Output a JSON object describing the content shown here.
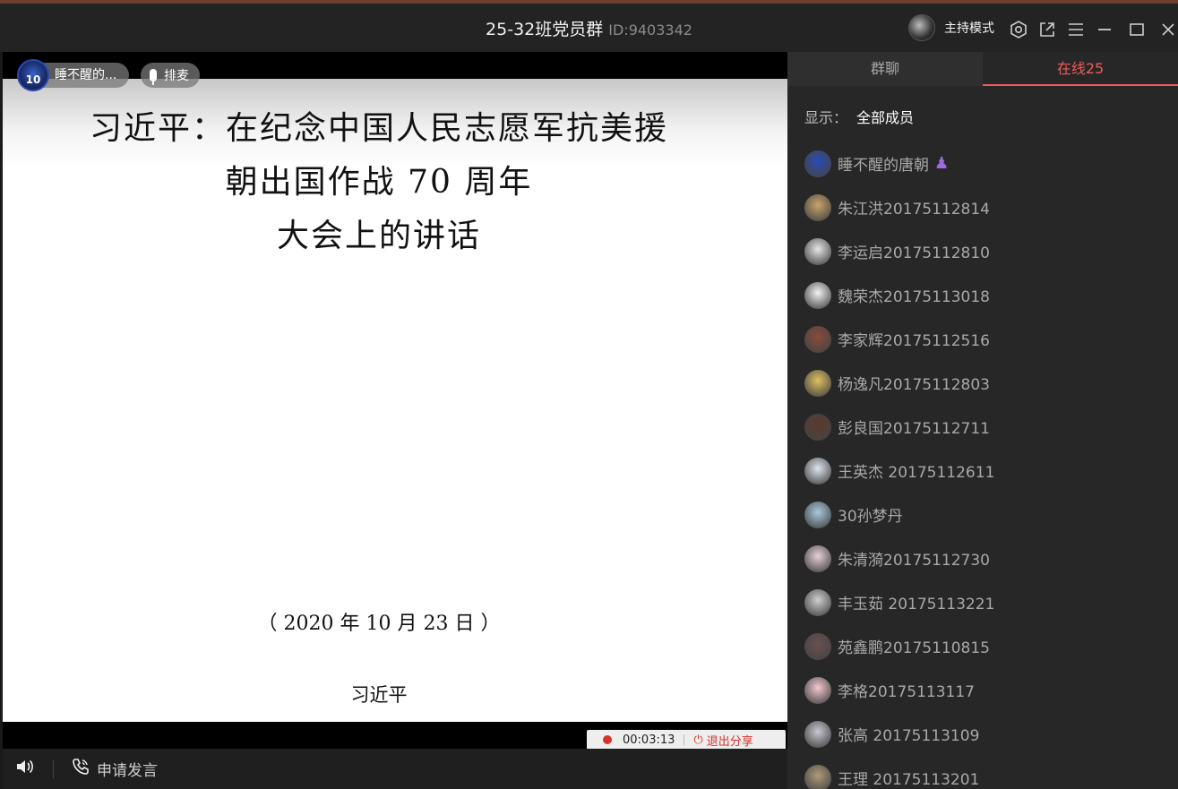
{
  "window": {
    "title": "25-32班党员群",
    "group_id": "ID:9403342",
    "mode_label": "主持模式"
  },
  "stage": {
    "speaker_name": "睡不醒的...",
    "speaker_avatar_text": "10",
    "queue_label": "排麦",
    "slide": {
      "title_line1": "习近平：在纪念中国人民志愿军抗美援",
      "title_line2": "朝出国作战 70 周年",
      "title_line3": "大会上的讲话",
      "date": "（ 2020 年 10 月 23 日 ）",
      "author": "习近平"
    },
    "share": {
      "timer": "00:03:13",
      "exit_label": "退出分享"
    }
  },
  "bottombar": {
    "apply_label": "申请发言"
  },
  "panel": {
    "tabs": [
      {
        "label": "群聊"
      },
      {
        "label": "在线25"
      }
    ],
    "show_label": "显示：",
    "show_value": "全部成员",
    "members": [
      {
        "name": "睡不醒的唐朝",
        "color": "#2b4bb5"
      },
      {
        "name": "朱江洪20175112814",
        "color": "#c9a46a"
      },
      {
        "name": "李运启20175112810",
        "color": "#e6e6e6"
      },
      {
        "name": "魏荣杰20175113018",
        "color": "#f2f2f2"
      },
      {
        "name": "李家辉20175112516",
        "color": "#8a4a3a"
      },
      {
        "name": "杨逸凡20175112803",
        "color": "#e0c060"
      },
      {
        "name": "彭良国20175112711",
        "color": "#5a3a2a"
      },
      {
        "name": "王英杰 20175112611",
        "color": "#dfe6f0"
      },
      {
        "name": "30孙梦丹",
        "color": "#a9c9dd"
      },
      {
        "name": "朱清漪20175112730",
        "color": "#e8cfd6"
      },
      {
        "name": "丰玉茹 20175113221",
        "color": "#cfcfcf"
      },
      {
        "name": "苑鑫鹏20175110815",
        "color": "#6a5050"
      },
      {
        "name": "李格20175113117",
        "color": "#f3c8d0"
      },
      {
        "name": "张高 20175113109",
        "color": "#c8c8d0"
      },
      {
        "name": "王理 20175113201",
        "color": "#b09a7a"
      }
    ]
  },
  "colors": {
    "accent": "#f05a5a",
    "record": "#d9322a"
  }
}
